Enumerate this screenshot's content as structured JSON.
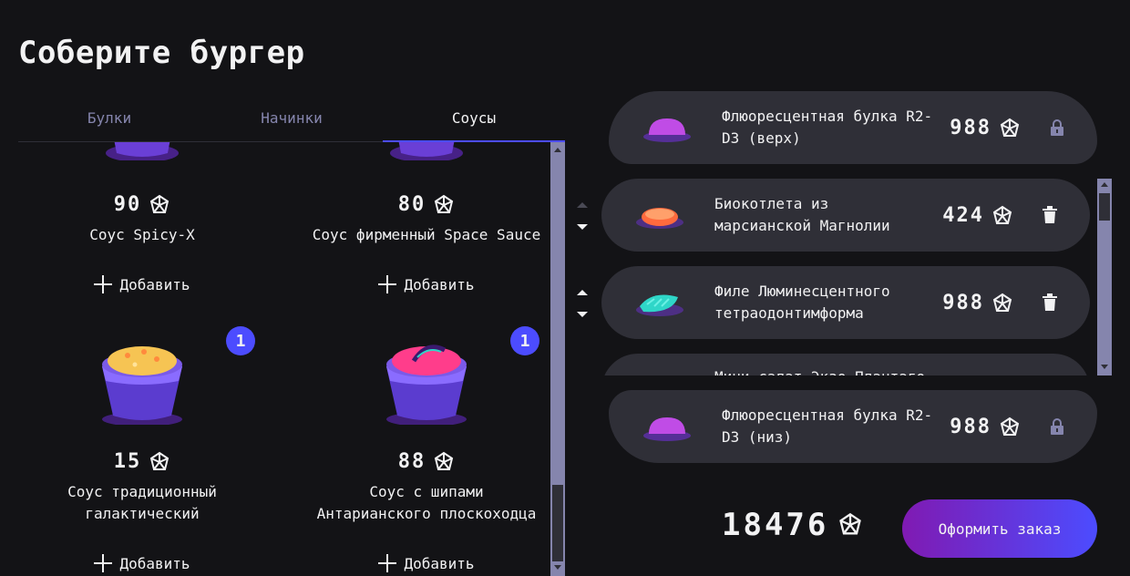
{
  "page": {
    "title": "Соберите бургер"
  },
  "tabs": [
    {
      "label": "Булки",
      "active": false
    },
    {
      "label": "Начинки",
      "active": false
    },
    {
      "label": "Соусы",
      "active": true
    }
  ],
  "ingredients": [
    {
      "price": "90",
      "name": "Соус Spicy-X",
      "add_label": "Добавить",
      "count": ""
    },
    {
      "price": "80",
      "name": "Соус фирменный Space Sauce",
      "add_label": "Добавить",
      "count": ""
    },
    {
      "price": "15",
      "name": "Соус традиционный галактический",
      "add_label": "Добавить",
      "count": "1"
    },
    {
      "price": "88",
      "name": "Соус с шипами Антарианского плоскоходца",
      "add_label": "Добавить",
      "count": "1"
    }
  ],
  "constructor": {
    "top_bun": {
      "name": "Флюоресцентная булка R2-D3 (верх)",
      "price": "988",
      "icon": "lock-icon"
    },
    "items": [
      {
        "name": "Биокотлета из марсианской Магнолии",
        "price": "424",
        "icon": "trash-icon"
      },
      {
        "name": "Филе Люминесцентного тетраодонтимформа",
        "price": "988",
        "icon": "trash-icon"
      },
      {
        "name": "Мини-салат Экзо-Плантаго",
        "price": ""
      }
    ],
    "bottom_bun": {
      "name": "Флюоресцентная булка R2-D3 (низ)",
      "price": "988",
      "icon": "lock-icon"
    }
  },
  "total": "18476",
  "order_button": "Оформить заказ",
  "colors": {
    "accent": "#4c4cff",
    "card": "#2f2f37",
    "bg": "#131316",
    "gradient_from": "#801ab2"
  }
}
